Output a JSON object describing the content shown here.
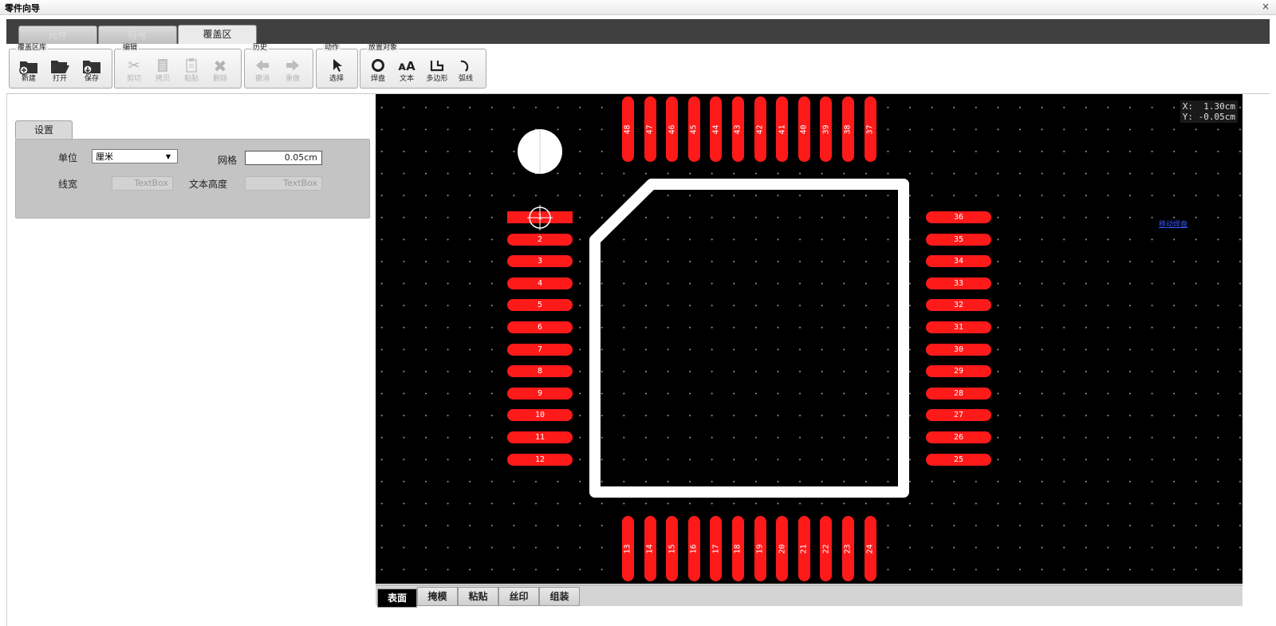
{
  "window": {
    "title": "零件向导",
    "close_glyph": "×"
  },
  "tabs": [
    {
      "label": "元件"
    },
    {
      "label": "符号"
    },
    {
      "label": "覆盖区"
    }
  ],
  "toolbar": {
    "groups": {
      "library": "覆盖区库",
      "edit": "编辑",
      "history": "历史",
      "action": "动作",
      "place": "放置对象"
    },
    "buttons": {
      "new": "新建",
      "open": "打开",
      "save": "保存",
      "cut": "剪切",
      "copy": "拷贝",
      "paste": "粘贴",
      "delete": "删除",
      "undo": "撤消",
      "redo": "重做",
      "select": "选择",
      "pad": "焊盘",
      "text": "文本",
      "polygon": "多边形",
      "arc": "弧线"
    }
  },
  "settings": {
    "tab": "设置",
    "unit_label": "单位",
    "unit_value": "厘米",
    "grid_label": "网格",
    "grid_value": "0.05cm",
    "linewidth_label": "线宽",
    "linewidth_placeholder": "TextBox",
    "textheight_label": "文本高度",
    "textheight_placeholder": "TextBox"
  },
  "canvas": {
    "coord_x": "X:  1.30cm",
    "coord_y": "Y: -0.05cm",
    "hint": "移动焊盘",
    "pad_color": "#ff1a1a",
    "outline_color": "#ffffff",
    "pads_left": [
      "1",
      "2",
      "3",
      "4",
      "5",
      "6",
      "7",
      "8",
      "9",
      "10",
      "11",
      "12"
    ],
    "pads_right": [
      "36",
      "35",
      "34",
      "33",
      "32",
      "31",
      "30",
      "29",
      "28",
      "27",
      "26",
      "25"
    ],
    "pads_top": [
      "48",
      "47",
      "46",
      "45",
      "44",
      "43",
      "42",
      "41",
      "40",
      "39",
      "38",
      "37"
    ],
    "pads_bottom": [
      "13",
      "14",
      "15",
      "16",
      "17",
      "18",
      "19",
      "20",
      "21",
      "22",
      "23",
      "24"
    ]
  },
  "layers": [
    {
      "label": "表面"
    },
    {
      "label": "掩模"
    },
    {
      "label": "粘贴"
    },
    {
      "label": "丝印"
    },
    {
      "label": "组装"
    }
  ]
}
